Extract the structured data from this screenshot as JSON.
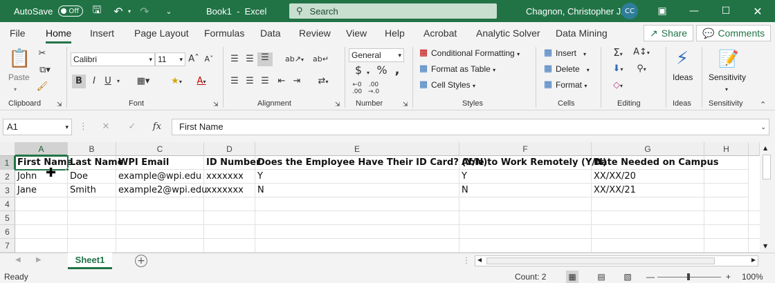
{
  "titlebar": {
    "autosave_label": "AutoSave",
    "autosave_state": "Off",
    "doc_title": "Book1  -  Excel",
    "search_placeholder": "Search",
    "user_name": "Chagnon, Christopher J.",
    "user_initials": "CC"
  },
  "menu": {
    "tabs": [
      "File",
      "Home",
      "Insert",
      "Page Layout",
      "Formulas",
      "Data",
      "Review",
      "View",
      "Help",
      "Acrobat",
      "Analytic Solver",
      "Data Mining"
    ],
    "share_label": "Share",
    "comments_label": "Comments"
  },
  "ribbon": {
    "paste_label": "Paste",
    "font_name": "Calibri",
    "font_size": "11",
    "bold_glyph": "B",
    "italic_glyph": "I",
    "underline_glyph": "U",
    "number_format": "General",
    "conditional_formatting": "Conditional Formatting",
    "format_as_table": "Format as Table",
    "cell_styles": "Cell Styles",
    "insert_label": "Insert",
    "delete_label": "Delete",
    "format_label": "Format",
    "ideas_label": "Ideas",
    "sensitivity_label": "Sensitivity",
    "groups": {
      "clipboard": "Clipboard",
      "font": "Font",
      "alignment": "Alignment",
      "number": "Number",
      "styles": "Styles",
      "cells": "Cells",
      "editing": "Editing",
      "ideas": "Ideas",
      "sensitivity": "Sensitivity"
    }
  },
  "formula": {
    "namebox": "A1",
    "fx_label": "fx",
    "value": "First Name"
  },
  "grid": {
    "columns": [
      "A",
      "B",
      "C",
      "D",
      "E",
      "F",
      "G",
      "H"
    ],
    "rows": [
      "1",
      "2",
      "3",
      "4",
      "5",
      "6",
      "7"
    ],
    "header_row": [
      "First Name",
      "Last Name",
      "WPI Email",
      "ID Number",
      "Does the Employee Have Their ID Card? (Y/N)",
      "Able to Work Remotely (Y/N)",
      "Date Needed on Campus"
    ],
    "data_rows": [
      [
        "John",
        "Doe",
        "example@wpi.edu",
        "xxxxxxx",
        "Y",
        "Y",
        "XX/XX/20"
      ],
      [
        "Jane",
        "Smith",
        "example2@wpi.edu",
        "xxxxxxx",
        "N",
        "N",
        "XX/XX/21"
      ]
    ]
  },
  "sheets": {
    "active": "Sheet1"
  },
  "status": {
    "ready": "Ready",
    "count": "Count: 2",
    "zoom": "100%"
  },
  "colors": {
    "brand": "#217346"
  }
}
